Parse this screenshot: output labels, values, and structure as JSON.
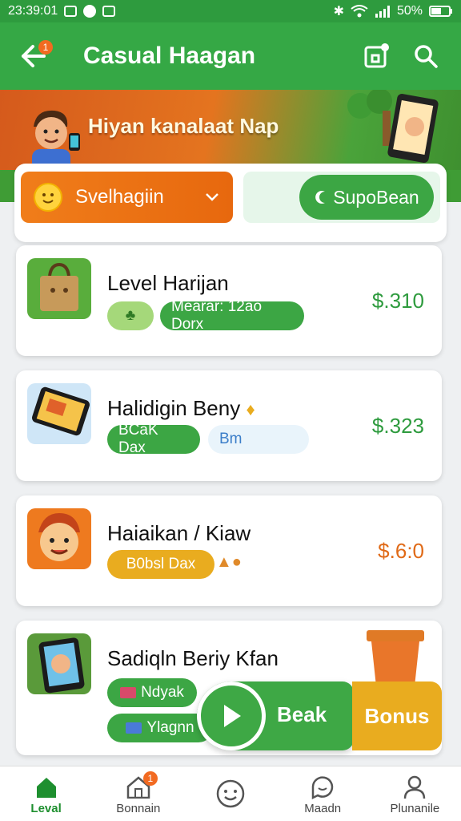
{
  "status_bar": {
    "time": "23:39:01",
    "battery": "50%"
  },
  "app_bar": {
    "title": "Casual Haagan",
    "back_badge": "1"
  },
  "banner": {
    "title": "Hiyan kanalaat Nap"
  },
  "filters": {
    "sort_label": "Svelhagiin",
    "toggle_label": "SupoBean"
  },
  "items": [
    {
      "name": "Level Harijan",
      "price": "$.310",
      "tag_icon": "♣",
      "tag": "Mearar: 12ao Dorx",
      "price_color": "#2e9b3e"
    },
    {
      "name": "Halidigin Beny",
      "price": "$.323",
      "tag": "BCaK Dax",
      "tag2": "Bm",
      "price_color": "#2e9b3e"
    },
    {
      "name": "Haiaikan / Kiaw",
      "price": "$.6:0",
      "tag": "B0bsl Dax",
      "price_color": "#e06a17"
    },
    {
      "name": "Sadiqln Beriy Kfan",
      "tag": "Ndyak",
      "tag2": "Ylagnn"
    }
  ],
  "cta": {
    "play_label": "Beak",
    "bonus_label": "Bonus"
  },
  "bottom_nav": [
    {
      "label": "Leval",
      "active": true
    },
    {
      "label": "Bonnain",
      "badge": "1"
    },
    {
      "label": ""
    },
    {
      "label": "Maadn"
    },
    {
      "label": "Plunanile"
    }
  ]
}
